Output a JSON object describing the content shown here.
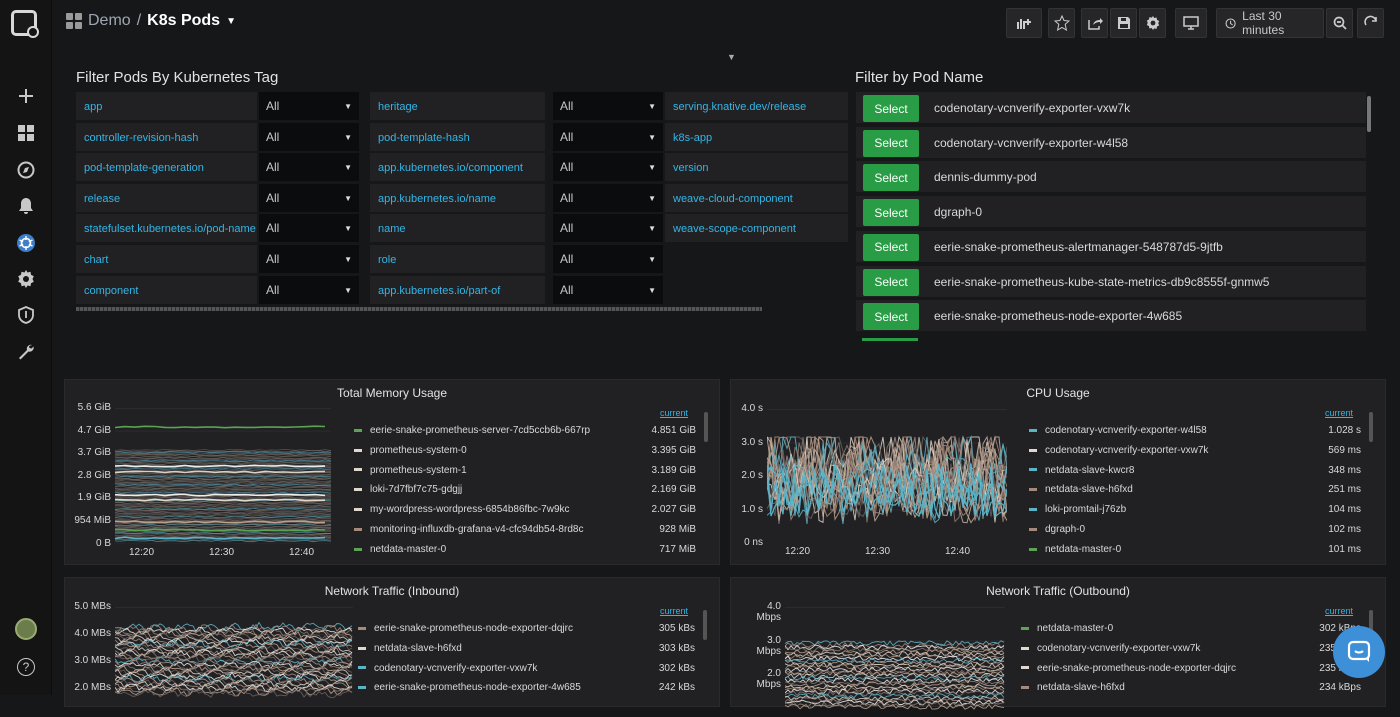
{
  "header": {
    "folder": "Demo",
    "separator": "/",
    "title": "K8s Pods",
    "time_range": "Last 30 minutes"
  },
  "tag_filter": {
    "title": "Filter Pods By Kubernetes Tag",
    "rows": [
      [
        {
          "label": "app",
          "value": "All"
        },
        {
          "label": "heritage",
          "value": "All"
        },
        {
          "label": "serving.knative.dev/release"
        }
      ],
      [
        {
          "label": "controller-revision-hash",
          "value": "All"
        },
        {
          "label": "pod-template-hash",
          "value": "All"
        },
        {
          "label": "k8s-app"
        }
      ],
      [
        {
          "label": "pod-template-generation",
          "value": "All"
        },
        {
          "label": "app.kubernetes.io/component",
          "value": "All"
        },
        {
          "label": "version"
        }
      ],
      [
        {
          "label": "release",
          "value": "All"
        },
        {
          "label": "app.kubernetes.io/name",
          "value": "All"
        },
        {
          "label": "weave-cloud-component"
        }
      ],
      [
        {
          "label": "statefulset.kubernetes.io/pod-name",
          "value": "All"
        },
        {
          "label": "name",
          "value": "All"
        },
        {
          "label": "weave-scope-component"
        }
      ],
      [
        {
          "label": "chart",
          "value": "All"
        },
        {
          "label": "role",
          "value": "All"
        }
      ],
      [
        {
          "label": "component",
          "value": "All"
        },
        {
          "label": "app.kubernetes.io/part-of",
          "value": "All"
        }
      ]
    ]
  },
  "pod_filter": {
    "title": "Filter by Pod Name",
    "button_label": "Select",
    "pods": [
      "codenotary-vcnverify-exporter-vxw7k",
      "codenotary-vcnverify-exporter-w4l58",
      "dennis-dummy-pod",
      "dgraph-0",
      "eerie-snake-prometheus-alertmanager-548787d5-9jtfb",
      "eerie-snake-prometheus-kube-state-metrics-db9c8555f-gnmw5",
      "eerie-snake-prometheus-node-exporter-4w685"
    ]
  },
  "panels": [
    {
      "title": "Total Memory Usage",
      "legend_header": "current",
      "y_ticks": [
        "5.6 GiB",
        "4.7 GiB",
        "3.7 GiB",
        "2.8 GiB",
        "1.9 GiB",
        "954 MiB",
        "0 B"
      ],
      "x_ticks": [
        "12:20",
        "12:30",
        "12:40"
      ],
      "legend": [
        {
          "name": "eerie-snake-prometheus-server-7cd5ccb6b-667rp",
          "value": "4.851 GiB",
          "color": "#5aa454"
        },
        {
          "name": "prometheus-system-0",
          "value": "3.395 GiB",
          "color": "#e0d8cc"
        },
        {
          "name": "prometheus-system-1",
          "value": "3.189 GiB",
          "color": "#e0d8cc"
        },
        {
          "name": "loki-7d7fbf7c75-gdgjj",
          "value": "2.169 GiB",
          "color": "#e0d8cc"
        },
        {
          "name": "my-wordpress-wordpress-6854b86fbc-7w9kc",
          "value": "2.027 GiB",
          "color": "#e0d8cc"
        },
        {
          "name": "monitoring-influxdb-grafana-v4-cfc94db54-8rd8c",
          "value": "928 MiB",
          "color": "#a58a7a"
        },
        {
          "name": "netdata-master-0",
          "value": "717 MiB",
          "color": "#5aa454"
        }
      ]
    },
    {
      "title": "CPU Usage",
      "legend_header": "current",
      "y_ticks": [
        "4.0 s",
        "3.0 s",
        "2.0 s",
        "1.0 s",
        "0 ns"
      ],
      "x_ticks": [
        "12:20",
        "12:30",
        "12:40"
      ],
      "legend": [
        {
          "name": "codenotary-vcnverify-exporter-w4l58",
          "value": "1.028 s",
          "color": "#5ab4c8"
        },
        {
          "name": "codenotary-vcnverify-exporter-vxw7k",
          "value": "569 ms",
          "color": "#e0d8cc"
        },
        {
          "name": "netdata-slave-kwcr8",
          "value": "348 ms",
          "color": "#5ab4c8"
        },
        {
          "name": "netdata-slave-h6fxd",
          "value": "251 ms",
          "color": "#a58a7a"
        },
        {
          "name": "loki-promtail-j76zb",
          "value": "104 ms",
          "color": "#5ab4c8"
        },
        {
          "name": "dgraph-0",
          "value": "102 ms",
          "color": "#a58a7a"
        },
        {
          "name": "netdata-master-0",
          "value": "101 ms",
          "color": "#5aa454"
        }
      ]
    },
    {
      "title": "Network Traffic (Inbound)",
      "legend_header": "current",
      "y_ticks": [
        "5.0 MBs",
        "4.0 MBs",
        "3.0 MBs",
        "2.0 MBs"
      ],
      "legend": [
        {
          "name": "eerie-snake-prometheus-node-exporter-dqjrc",
          "value": "305 kBs",
          "color": "#a58a7a"
        },
        {
          "name": "netdata-slave-h6fxd",
          "value": "303 kBs",
          "color": "#e0d8cc"
        },
        {
          "name": "codenotary-vcnverify-exporter-vxw7k",
          "value": "302 kBs",
          "color": "#5ab4c8"
        },
        {
          "name": "eerie-snake-prometheus-node-exporter-4w685",
          "value": "242 kBs",
          "color": "#5ab4c8"
        }
      ]
    },
    {
      "title": "Network Traffic (Outbound)",
      "legend_header": "current",
      "y_ticks": [
        "4.0 Mbps",
        "3.0 Mbps",
        "2.0 Mbps"
      ],
      "legend": [
        {
          "name": "netdata-master-0",
          "value": "302 kBps",
          "color": "#5aa454"
        },
        {
          "name": "codenotary-vcnverify-exporter-vxw7k",
          "value": "235 kBps",
          "color": "#e0d8cc"
        },
        {
          "name": "eerie-snake-prometheus-node-exporter-dqjrc",
          "value": "235 kBps",
          "color": "#e0d8cc"
        },
        {
          "name": "netdata-slave-h6fxd",
          "value": "234 kBps",
          "color": "#a58a7a"
        }
      ]
    }
  ],
  "icons": {
    "logo": "grafana-logo",
    "plus": "plus-icon",
    "dashboards": "dashboards-icon",
    "explore": "compass-icon",
    "alerting": "bell-icon",
    "kubernetes": "kubernetes-icon",
    "config": "gear-icon",
    "shield": "shield-icon",
    "admin": "wrench-icon",
    "avatar": "avatar",
    "help": "help-icon",
    "chat": "chat-icon"
  }
}
